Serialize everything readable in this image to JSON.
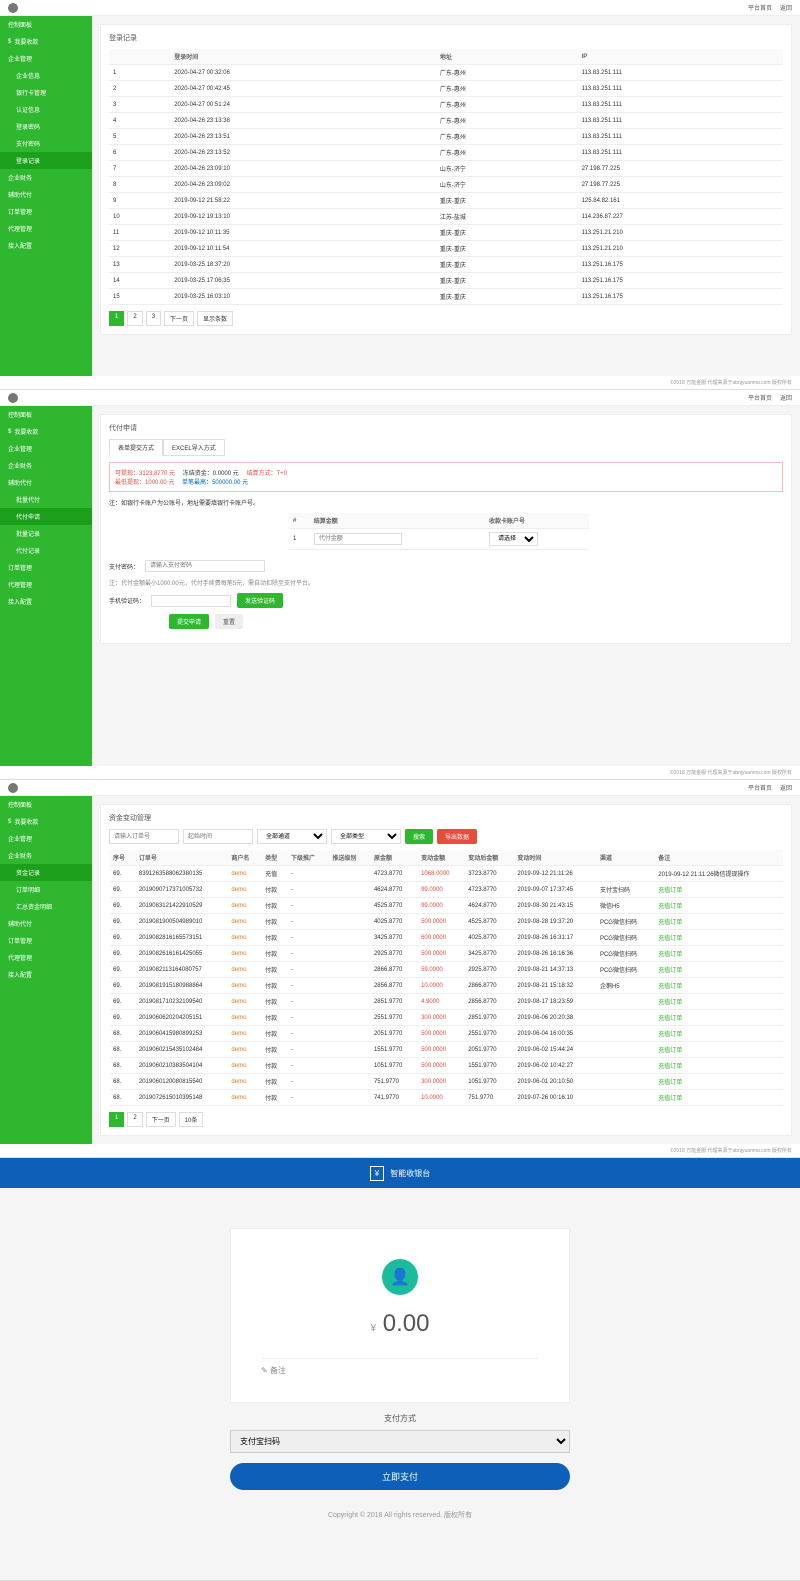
{
  "top": {
    "home": "平台首页",
    "back": "返回"
  },
  "sidebar1": {
    "title": "控制面板",
    "items": [
      "我要收款",
      "企业管理"
    ],
    "subs": [
      "企业信息",
      "银行卡管理",
      "认证信息",
      "登录密码",
      "支付密码",
      "登录记录"
    ],
    "items2": [
      "企业财务",
      "辅助代付",
      "订单管理",
      "代理管理",
      "接入配置"
    ]
  },
  "p1": {
    "title": "登录记录",
    "headers": [
      "",
      "登录时间",
      "地址",
      "IP"
    ],
    "rows": [
      [
        "1",
        "2020-04-27 00:32:06",
        "广东-惠州",
        "113.83.251.111"
      ],
      [
        "2",
        "2020-04-27 00:42:45",
        "广东-惠州",
        "113.83.251.111"
      ],
      [
        "3",
        "2020-04-27 00:51:24",
        "广东-惠州",
        "113.83.251.111"
      ],
      [
        "4",
        "2020-04-26 23:13:38",
        "广东-惠州",
        "113.83.251.111"
      ],
      [
        "5",
        "2020-04-26 23:13:51",
        "广东-惠州",
        "113.83.251.111"
      ],
      [
        "6",
        "2020-04-26 23:13:52",
        "广东-惠州",
        "113.83.251.111"
      ],
      [
        "7",
        "2020-04-26 23:09:10",
        "山东-济宁",
        "27.198.77.225"
      ],
      [
        "8",
        "2020-04-26 23:09:02",
        "山东-济宁",
        "27.198.77.225"
      ],
      [
        "9",
        "2019-09-12 21:58:22",
        "重庆-重庆",
        "125.84.82.161"
      ],
      [
        "10",
        "2019-09-12 19:13:10",
        "江苏-盐城",
        "114.236.87.227"
      ],
      [
        "11",
        "2019-09-12 10:11:35",
        "重庆-重庆",
        "113.251.21.210"
      ],
      [
        "12",
        "2019-09-12 10:11:54",
        "重庆-重庆",
        "113.251.21.210"
      ],
      [
        "13",
        "2019-03-25 18:37:20",
        "重庆-重庆",
        "113.251.16.175"
      ],
      [
        "14",
        "2019-03-25 17:06:35",
        "重庆-重庆",
        "113.251.16.175"
      ],
      [
        "15",
        "2019-03-25 16:03:10",
        "重庆-重庆",
        "113.251.16.175"
      ]
    ],
    "pager": [
      "1",
      "2",
      "3",
      "下一页",
      "显示条数"
    ]
  },
  "footer": "©2018 万能金服 代理来源于abnjyuanma.com 版权所有",
  "sidebar2": {
    "items": [
      "我要收款",
      "企业管理",
      "企业财务",
      "辅助代付"
    ],
    "subs": [
      "批量代付",
      "代付申请",
      "批量记录",
      "代付记录"
    ],
    "items2": [
      "订单管理",
      "代理管理",
      "接入配置"
    ]
  },
  "p2": {
    "title": "代付申请",
    "tabs": [
      "表单提交方式",
      "EXCEL导入方式"
    ],
    "notice": {
      "l1a": "可提现：",
      "l1b": "3123.8770 元",
      "l1c": "冻结资金：",
      "l1d": "0.0000 元",
      "l1e": "结算方式：",
      "l1f": "T+0",
      "l2a": "最低提现：",
      "l2b": "1000.00 元",
      "l2c": "单笔最高：",
      "l2d": "500000.00 元"
    },
    "tip": "注：如银行卡账户为公账号，地址需要填银行卡账户号。",
    "th": [
      "#",
      "结算金额",
      "收款卡账户号"
    ],
    "tr": [
      "1",
      "代付金额"
    ],
    "sel": "请选择",
    "f1": "支付密码：",
    "ph1": "请输入支付密码",
    "f2": "注：代付金额最小1000.00元，代付手续费每笔5元，需自动扣除至支付平台。",
    "f3": "手机验证码：",
    "btn1": "发送验证码",
    "btn2": "提交申请",
    "btn3": "重置"
  },
  "sidebar3": {
    "items": [
      "我要收款",
      "企业管理",
      "企业财务"
    ],
    "subs": [
      "资金记录",
      "订单明细",
      "汇总资金明细"
    ],
    "items2": [
      "辅助代付",
      "订单管理",
      "代理管理",
      "接入配置"
    ]
  },
  "p3": {
    "title": "资金变动管理",
    "ph": "请输入订单号",
    "d": "起始时间",
    "s1": "全部通道",
    "s2": "全部类型",
    "b1": "搜索",
    "b2": "导出数据",
    "headers": [
      "序号",
      "订单号",
      "商户名",
      "类型",
      "下级推广",
      "推送级别",
      "原金额",
      "变动金额",
      "变动后金额",
      "变动时间",
      "渠道",
      "备注"
    ],
    "rows": [
      [
        "69.",
        "8391263588062380135",
        "demo",
        "充值",
        "-",
        "",
        "4723.8770",
        "1068.0000",
        "3723.8770",
        "2019-09-12 21:11:26",
        "",
        "2019-09-12 21:11:26微信提现操作"
      ],
      [
        "69.",
        "2019090717371005732",
        "demo",
        "付款",
        "-",
        "",
        "4624.8770",
        "99.0000",
        "4723.8770",
        "2019-09-07 17:37:45",
        "支付宝扫码",
        "充值订单"
      ],
      [
        "69.",
        "2019083121422910529",
        "demo",
        "付款",
        "-",
        "",
        "4525.8770",
        "99.0000",
        "4624.8770",
        "2019-08-30 21:43:15",
        "微信H5",
        "充值订单"
      ],
      [
        "69.",
        "2019081900504989010",
        "demo",
        "付款",
        "-",
        "",
        "4025.8770",
        "500.0000",
        "4525.8770",
        "2019-08-28 19:37:20",
        "PCG微信扫码",
        "充值订单"
      ],
      [
        "69.",
        "2019082816165573151",
        "demo",
        "付款",
        "-",
        "",
        "3425.8770",
        "600.0000",
        "4025.8770",
        "2019-08-26 16:31:17",
        "PCG微信扫码",
        "充值订单"
      ],
      [
        "69.",
        "2019082616161425055",
        "demo",
        "付款",
        "-",
        "",
        "2925.8770",
        "500.0000",
        "3425.8770",
        "2019-08-26 16:16:36",
        "PCG微信扫码",
        "充值订单"
      ],
      [
        "69.",
        "2019082113164080757",
        "demo",
        "付款",
        "-",
        "",
        "2866.8770",
        "59.0000",
        "2925.8770",
        "2019-08-21 14:37:13",
        "PCG微信扫码",
        "充值订单"
      ],
      [
        "69.",
        "2019081915180988864",
        "demo",
        "付款",
        "-",
        "",
        "2856.8770",
        "10.0000",
        "2866.8770",
        "2019-08-21 15:18:32",
        "企鹅H5",
        "充值订单"
      ],
      [
        "69.",
        "2019081710232109540",
        "demo",
        "付款",
        "-",
        "",
        "2851.9770",
        "4.9000",
        "2856.8770",
        "2019-08-17 18:23:59",
        "",
        "充值订单"
      ],
      [
        "69.",
        "2019060620204205151",
        "demo",
        "付款",
        "-",
        "",
        "2551.9770",
        "300.0000",
        "2851.9770",
        "2019-06-06 20:20:38",
        "",
        "充值订单"
      ],
      [
        "68.",
        "2019060415980899253",
        "demo",
        "付款",
        "-",
        "",
        "2051.9770",
        "500.0000",
        "2551.9770",
        "2019-06-04 16:00:35",
        "",
        "充值订单"
      ],
      [
        "68.",
        "2019060215435102484",
        "demo",
        "付款",
        "-",
        "",
        "1551.9770",
        "500.0000",
        "2051.9770",
        "2019-06-02 15:44:24",
        "",
        "充值订单"
      ],
      [
        "68.",
        "2019060210383504104",
        "demo",
        "付款",
        "-",
        "",
        "1051.9770",
        "500.0000",
        "1551.9770",
        "2019-06-02 10:42:27",
        "",
        "充值订单"
      ],
      [
        "68.",
        "2019060120080815540",
        "demo",
        "付款",
        "-",
        "",
        "751.9770",
        "300.0000",
        "1051.9770",
        "2019-06-01 20:10:50",
        "",
        "充值订单"
      ],
      [
        "68.",
        "2019072615010395148",
        "demo",
        "付款",
        "-",
        "",
        "741.9770",
        "10.0000",
        "751.9770",
        "2019-07-26 00:16:10",
        "",
        "充值订单"
      ]
    ],
    "pager": [
      "1",
      "2",
      "下一页",
      "10条"
    ]
  },
  "cashier": {
    "bar": "智能收银台",
    "cur": "¥",
    "amt": "0.00",
    "remark": "备注",
    "method": "支付方式",
    "opt": "支付宝扫码",
    "btn": "立即支付",
    "copy": "Copyright © 2018 All rights reserved. 版权所有"
  }
}
